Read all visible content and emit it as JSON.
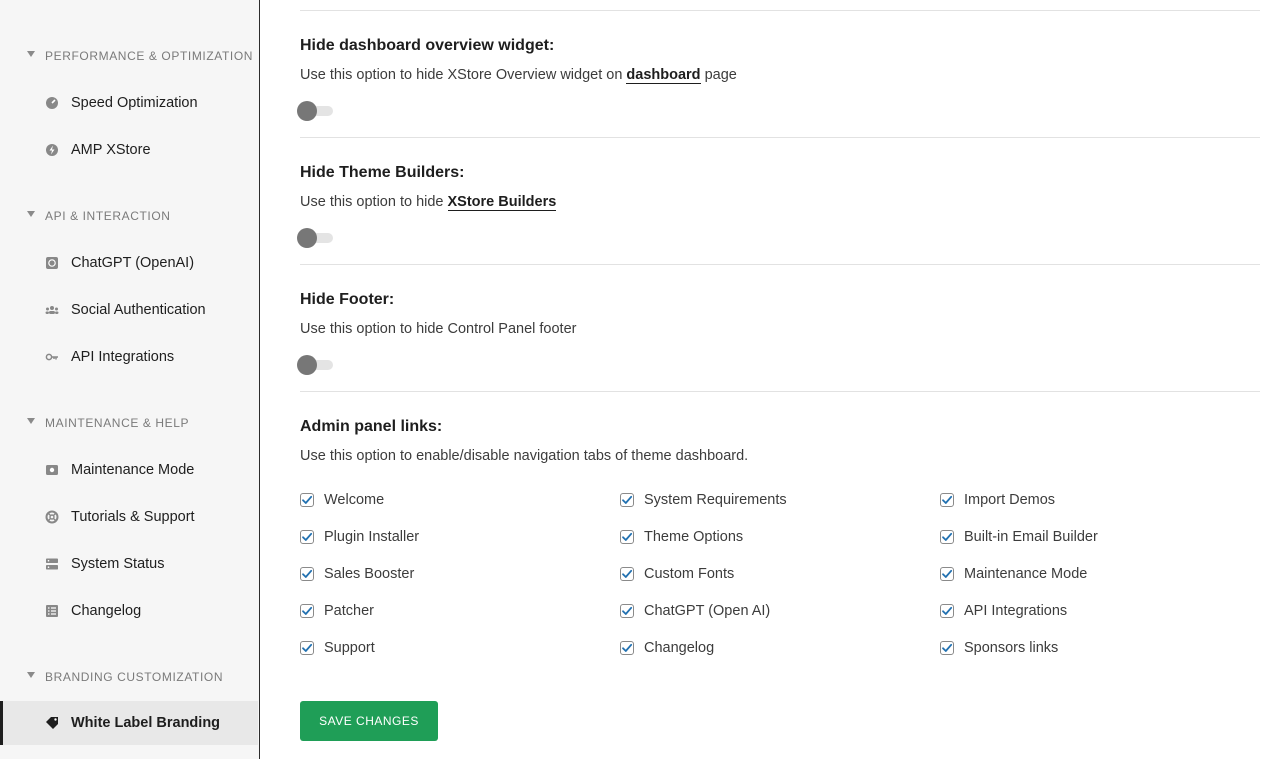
{
  "sidebar": {
    "sections": [
      {
        "title": "PERFORMANCE & OPTIMIZATION",
        "items": [
          {
            "label": "Speed Optimization",
            "icon": "gauge-icon"
          },
          {
            "label": "AMP XStore",
            "icon": "bolt-icon"
          }
        ]
      },
      {
        "title": "API & INTERACTION",
        "items": [
          {
            "label": "ChatGPT (OpenAI)",
            "icon": "openai-icon"
          },
          {
            "label": "Social Authentication",
            "icon": "users-icon"
          },
          {
            "label": "API Integrations",
            "icon": "key-icon"
          }
        ]
      },
      {
        "title": "MAINTENANCE & HELP",
        "items": [
          {
            "label": "Maintenance Mode",
            "icon": "maintenance-icon"
          },
          {
            "label": "Tutorials & Support",
            "icon": "lifebuoy-icon"
          },
          {
            "label": "System Status",
            "icon": "server-icon"
          },
          {
            "label": "Changelog",
            "icon": "list-icon"
          }
        ]
      },
      {
        "title": "BRANDING CUSTOMIZATION",
        "items": [
          {
            "label": "White Label Branding",
            "icon": "tag-icon",
            "active": true
          }
        ]
      }
    ]
  },
  "options": {
    "dashboard_widget": {
      "title": "Hide dashboard overview widget:",
      "desc_before": "Use this option to hide XStore Overview widget on ",
      "link": "dashboard",
      "desc_after": " page",
      "enabled": false
    },
    "theme_builders": {
      "title": "Hide Theme Builders:",
      "desc_before": "Use this option to hide ",
      "link": "XStore Builders",
      "enabled": false
    },
    "footer": {
      "title": "Hide Footer:",
      "desc": "Use this option to hide Control Panel footer",
      "enabled": false
    },
    "admin_links": {
      "title": "Admin panel links:",
      "desc": "Use this option to enable/disable navigation tabs of theme dashboard.",
      "columns": [
        [
          "Welcome",
          "Plugin Installer",
          "Sales Booster",
          "Patcher",
          "Support"
        ],
        [
          "System Requirements",
          "Theme Options",
          "Custom Fonts",
          "ChatGPT (Open AI)",
          "Changelog"
        ],
        [
          "Import Demos",
          "Built-in Email Builder",
          "Maintenance Mode",
          "API Integrations",
          "Sponsors links"
        ]
      ]
    }
  },
  "save_button": "SAVE CHANGES",
  "colors": {
    "accent": "#1f9e57",
    "checkbox": "#2271b1",
    "toggle_knob": "#777777"
  }
}
